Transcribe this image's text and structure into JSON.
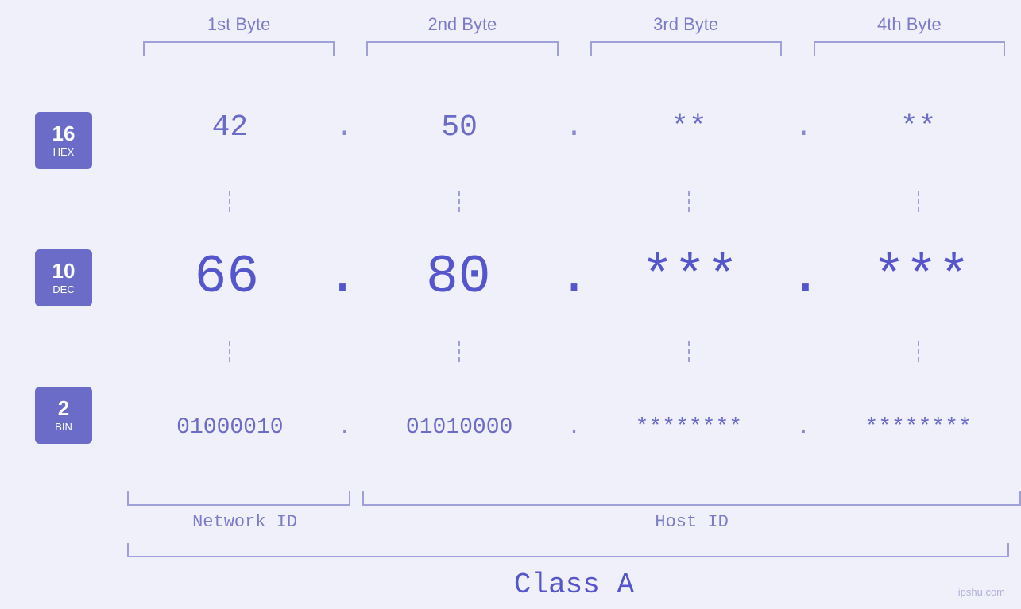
{
  "header": {
    "byte1": "1st Byte",
    "byte2": "2nd Byte",
    "byte3": "3rd Byte",
    "byte4": "4th Byte"
  },
  "badges": {
    "hex": {
      "num": "16",
      "label": "HEX"
    },
    "dec": {
      "num": "10",
      "label": "DEC"
    },
    "bin": {
      "num": "2",
      "label": "BIN"
    }
  },
  "rows": {
    "hex": {
      "b1": "42",
      "b2": "50",
      "b3": "**",
      "b4": "**"
    },
    "dec": {
      "b1": "66",
      "b2": "80",
      "b3": "***",
      "b4": "***"
    },
    "bin": {
      "b1": "01000010",
      "b2": "01010000",
      "b3": "********",
      "b4": "********"
    }
  },
  "labels": {
    "network_id": "Network ID",
    "host_id": "Host ID",
    "class": "Class A"
  },
  "dot": ".",
  "watermark": "ipshu.com"
}
